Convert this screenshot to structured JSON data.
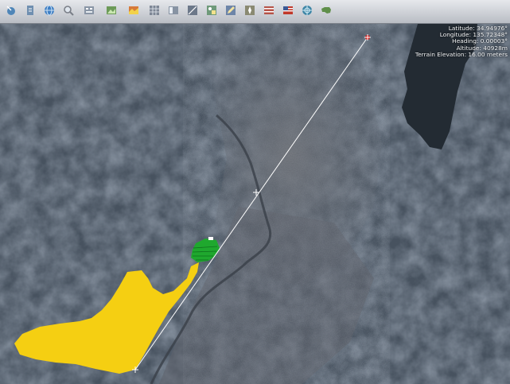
{
  "toolbar": {
    "buttons": [
      {
        "icon": "globe-pointer-icon",
        "color": "#4f86b8"
      },
      {
        "icon": "document-icon",
        "color": "#6f8fb0"
      },
      {
        "icon": "globe-icon",
        "color": "#3f7fc4"
      },
      {
        "icon": "magnifier-icon",
        "color": "#7a7f88"
      },
      {
        "icon": "layer-grid-icon",
        "color": "#8a96a6"
      },
      {
        "icon": "photo-layer-icon",
        "color": "#6c9a58"
      },
      {
        "icon": "elevation-map-icon",
        "color": "#d77a3a"
      },
      {
        "icon": "grid-overlay-icon",
        "color": "#7e8796"
      },
      {
        "icon": "panel-icon",
        "color": "#8793a3"
      },
      {
        "icon": "measure-tool-icon",
        "color": "#6c7889"
      },
      {
        "icon": "shapes-icon",
        "color": "#6f9a7a"
      },
      {
        "icon": "pencil-icon",
        "color": "#6d85a8"
      },
      {
        "icon": "compass-tool-icon",
        "color": "#8a8a72"
      },
      {
        "icon": "flag-icon",
        "color": "#b55247"
      },
      {
        "icon": "us-flag-icon",
        "color": "#3b5a96"
      },
      {
        "icon": "globe-grid-icon",
        "color": "#3e86a6"
      },
      {
        "icon": "usa-map-icon",
        "color": "#5f8f4a"
      }
    ]
  },
  "status": {
    "latitude": "Latitude: 34.94976°",
    "longitude": "Longitude: 135.72348°",
    "heading": "Heading: 0.00003°",
    "altitude": "Altitude: 40928m",
    "terrain": "Terrain Elevation: 16.00 meters"
  },
  "colors": {
    "terrain_base": "#4a5564",
    "valley": "#606670",
    "lake": "#242d35",
    "polygon_yellow": "#f5cf12",
    "polygon_green": "#1fa82e",
    "measure_line": "#ffffff",
    "end_marker": "#d01818"
  }
}
